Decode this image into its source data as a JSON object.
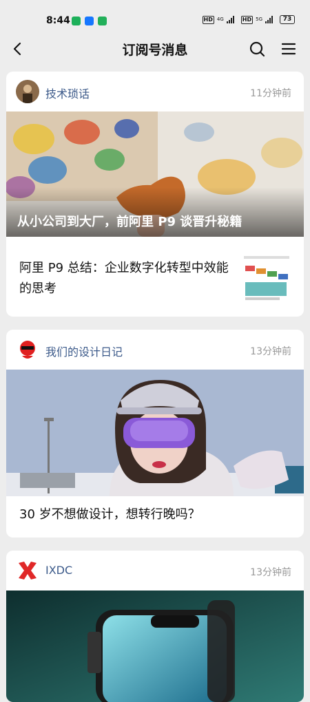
{
  "status_bar": {
    "time": "8:44",
    "hd1": "HD",
    "net1": "4G",
    "hd2": "HD",
    "net2": "5G",
    "battery": "73"
  },
  "nav": {
    "title": "订阅号消息",
    "icons": [
      "back-icon",
      "search-icon",
      "menu-icon"
    ]
  },
  "feed": [
    {
      "account": "技术琐话",
      "time": "11分钟前",
      "hero_caption": "从小公司到大厂，前阿里 P9 谈晋升秘籍",
      "articles": [
        {
          "title_line1": "阿里 P9 总结：企业数字化转型中效能",
          "title_line2": "的思考"
        }
      ]
    },
    {
      "account": "我们的设计日记",
      "time": "13分钟前",
      "articles": [
        {
          "title_line1": "30 岁不想做设计，想转行晚吗？"
        }
      ]
    },
    {
      "account": "IXDC",
      "time": "13分钟前"
    }
  ],
  "colors": {
    "account_name": "#3c5a8a",
    "time": "#999999",
    "background": "#ededed",
    "card": "#ffffff"
  }
}
